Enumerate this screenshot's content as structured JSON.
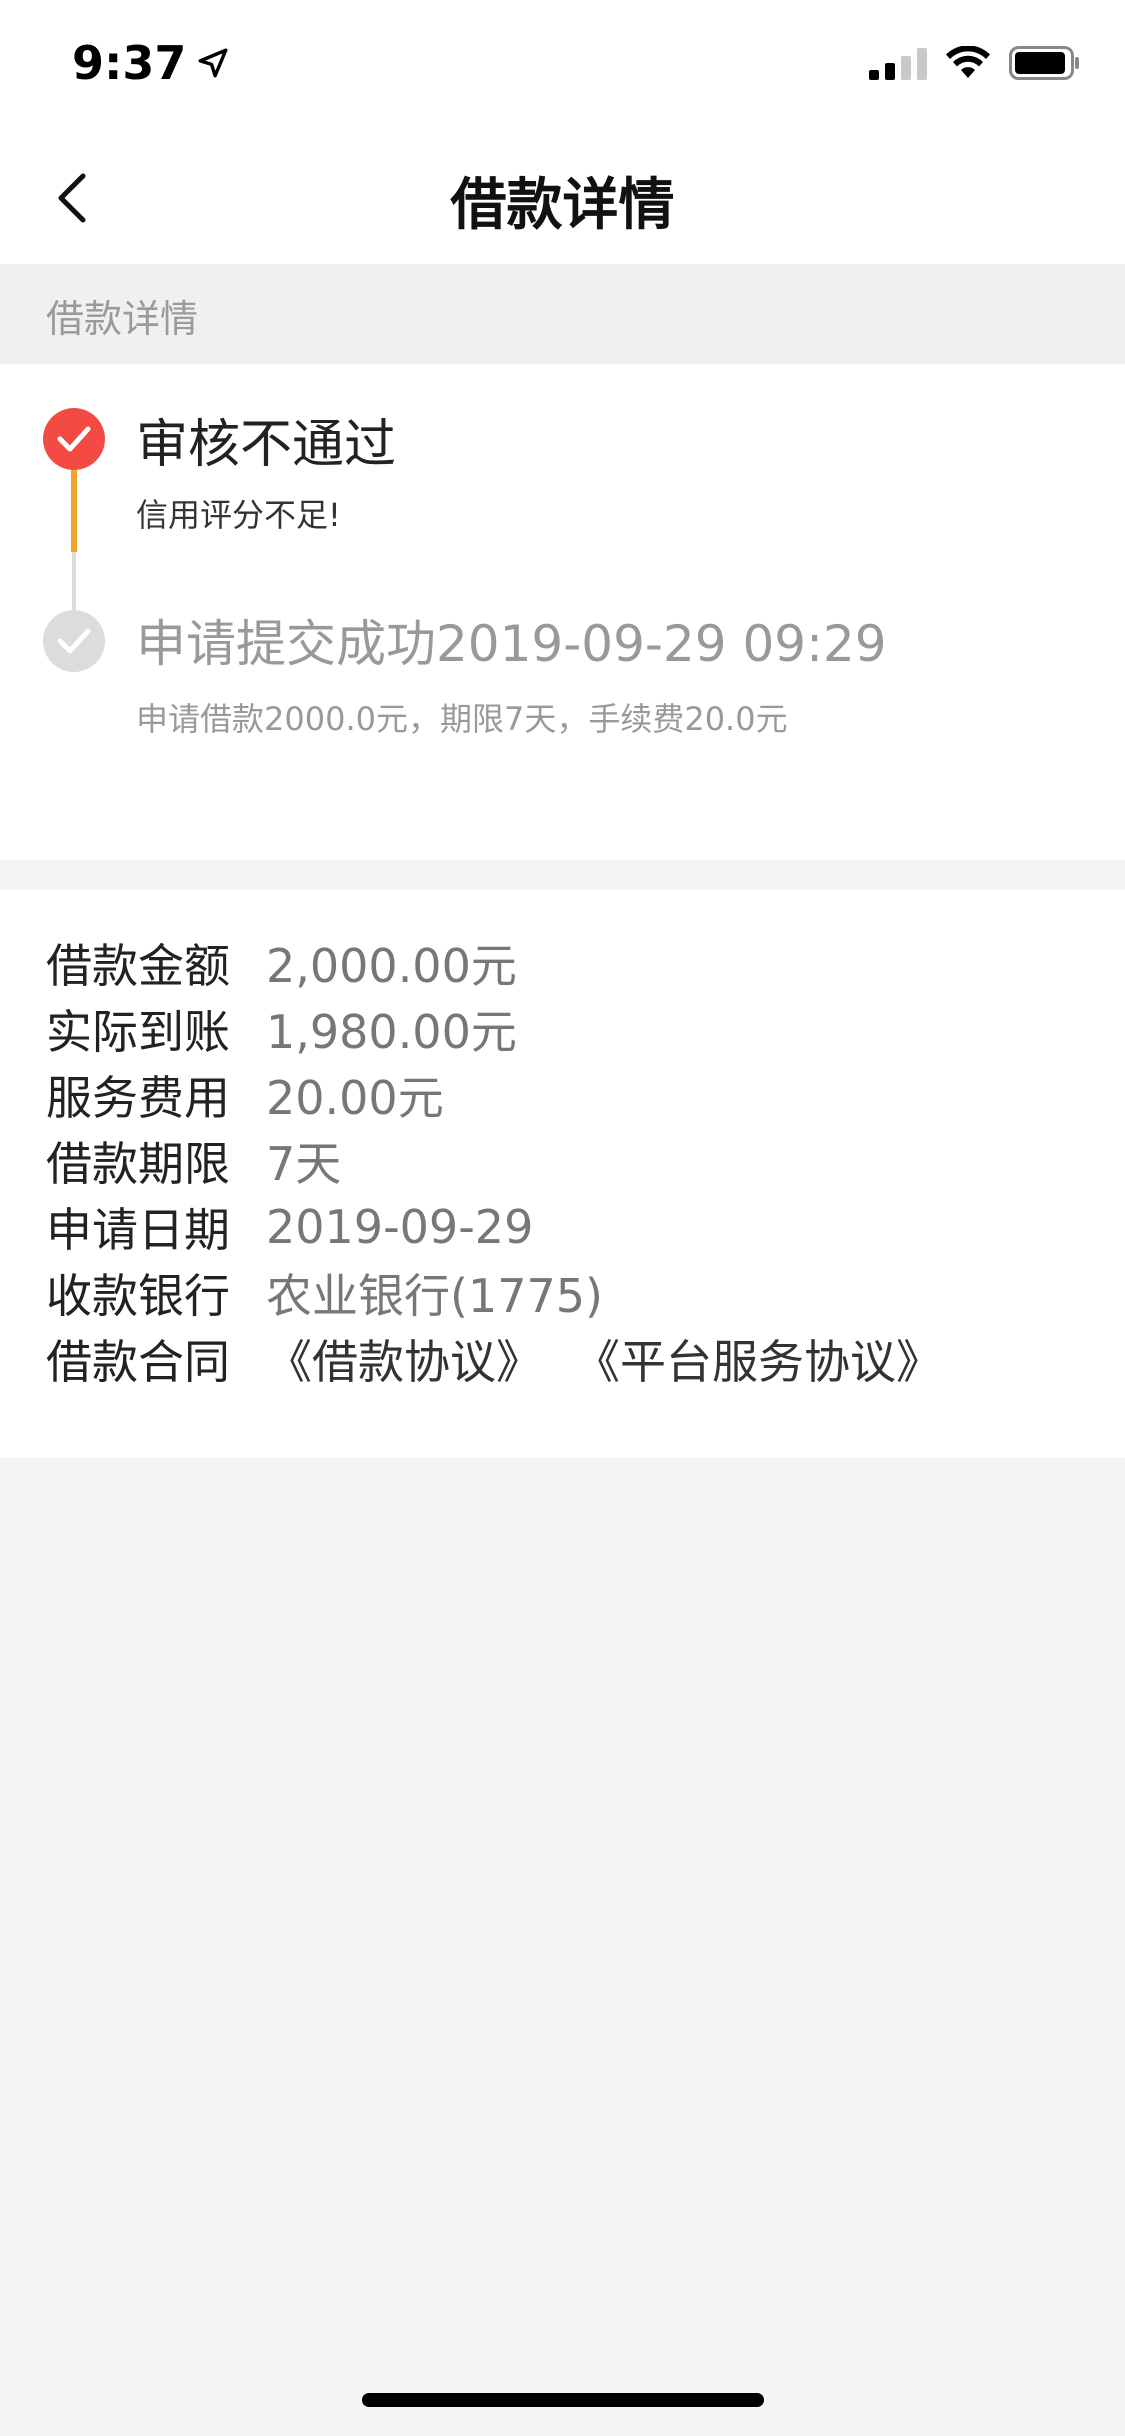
{
  "status_bar": {
    "time": "9:37",
    "icons": [
      "location-arrow-icon",
      "cellular-signal-icon",
      "wifi-icon",
      "battery-icon"
    ]
  },
  "nav": {
    "title": "借款详情",
    "back_icon": "chevron-left-icon"
  },
  "section": {
    "header": "借款详情"
  },
  "timeline": {
    "steps": [
      {
        "title": "审核不通过",
        "desc": "信用评分不足!",
        "state": "rejected",
        "color": "#f34b43"
      },
      {
        "title": "申请提交成功2019-09-29 09:29",
        "desc": "申请借款2000.0元，期限7天，手续费20.0元",
        "state": "done",
        "color": "#dcdcdc"
      }
    ],
    "connector_color": "#f2a72b"
  },
  "details": {
    "rows": [
      {
        "label": "借款金额",
        "value": "2,000.00元"
      },
      {
        "label": "实际到账",
        "value": "1,980.00元"
      },
      {
        "label": "服务费用",
        "value": "20.00元"
      },
      {
        "label": "借款期限",
        "value": "7天"
      },
      {
        "label": "申请日期",
        "value": "2019-09-29"
      },
      {
        "label": "收款银行",
        "value": "农业银行(1775)"
      }
    ],
    "contract": {
      "label": "借款合同",
      "links": [
        "《借款协议》",
        "《平台服务协议》"
      ]
    }
  }
}
